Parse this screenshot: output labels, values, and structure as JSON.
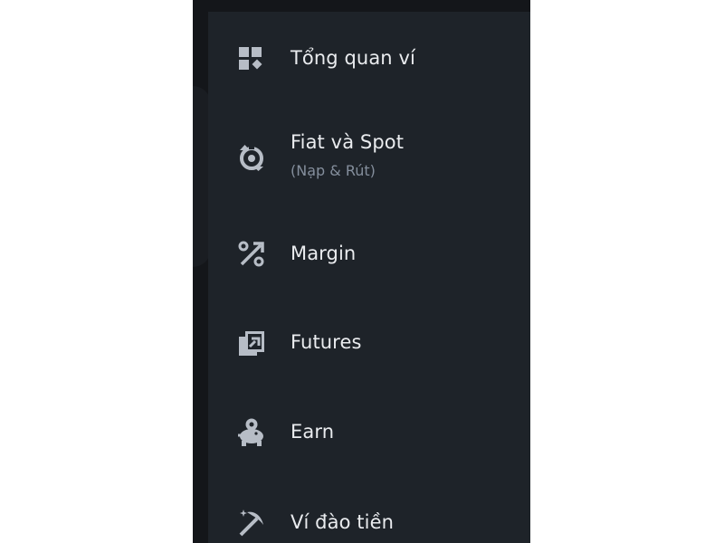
{
  "colors": {
    "sidebar_bg": "#1e2329",
    "backdrop_bg": "#14161a",
    "label_text": "#eaecef",
    "sublabel_text": "#848e9c",
    "icon": "#b7bdc6"
  },
  "menu": {
    "items": [
      {
        "label": "Tổng quan ví",
        "icon": "dashboard-icon"
      },
      {
        "label": "Fiat và Spot",
        "sublabel": "(Nạp & Rút)",
        "icon": "fiat-spot-icon"
      },
      {
        "label": "Margin",
        "icon": "margin-icon"
      },
      {
        "label": "Futures",
        "icon": "futures-icon"
      },
      {
        "label": "Earn",
        "icon": "piggy-bank-icon"
      },
      {
        "label": "Ví đào tiền",
        "icon": "pickaxe-icon"
      }
    ]
  }
}
